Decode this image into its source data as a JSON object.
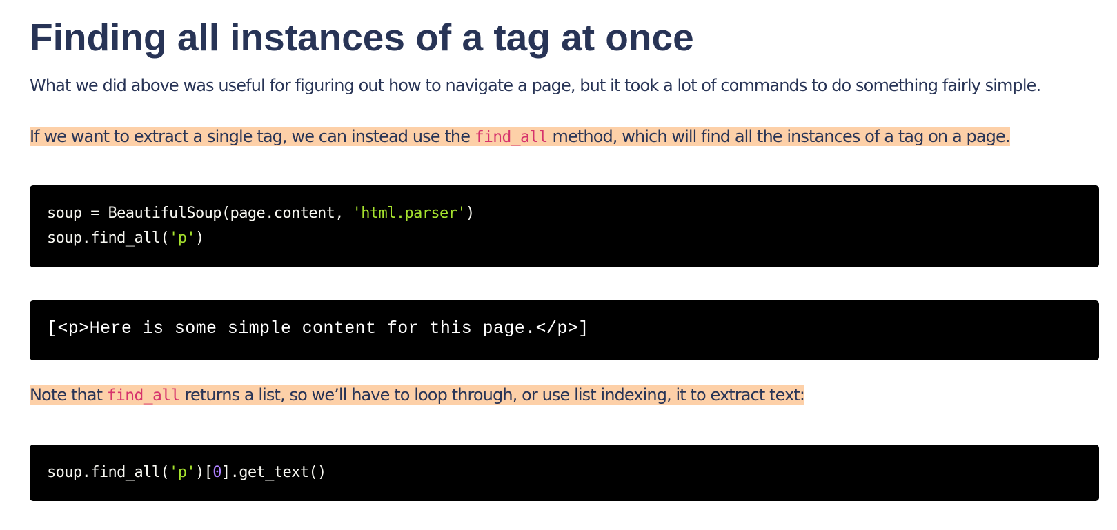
{
  "heading": "Finding all instances of a tag at once",
  "intro_paragraph": "What we did above was useful for figuring out how to navigate a page, but it took a lot of commands to do something fairly simple.",
  "para_find_all": {
    "before": "If we want to extract a single tag, we can instead use the ",
    "code": "find_all",
    "after": " method, which will find all the instances of a tag on a page."
  },
  "code_block_1": {
    "line1": {
      "part1": "soup = BeautifulSoup(page.content, ",
      "string": "'html.parser'",
      "part2": ")"
    },
    "line2": {
      "part1": "soup.find_all(",
      "string": "'p'",
      "part2": ")"
    }
  },
  "output_block": {
    "text": "[<p>Here is some simple content for this page.</p>]"
  },
  "para_note": {
    "before": "Note that ",
    "code": "find_all",
    "after": " returns a list, so we’ll have to loop through, or use list indexing, it to extract text:"
  },
  "code_block_2": {
    "part1": "soup.find_all(",
    "string": "'p'",
    "part2": ")[",
    "number": "0",
    "part3": "].get_text()"
  },
  "colors": {
    "heading_text": "#283456",
    "highlight": "#fdd0a8",
    "inline_code": "#d6336c",
    "code_background": "#000000",
    "code_string": "#a6e22e",
    "code_number": "#ae81ff"
  }
}
